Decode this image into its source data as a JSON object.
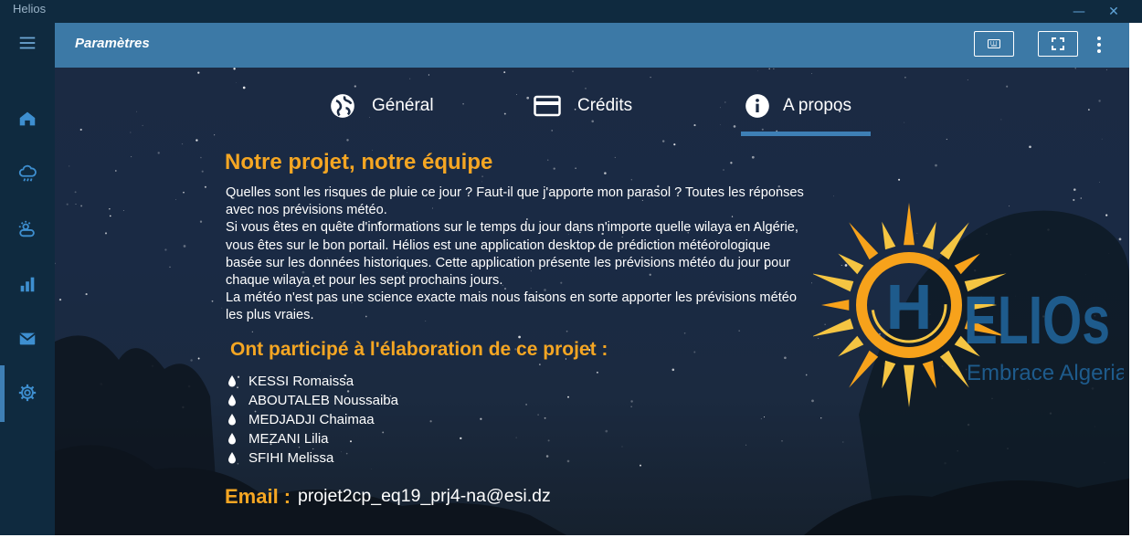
{
  "app": {
    "title": "Helios"
  },
  "window_controls": {
    "minimize": "—",
    "close": "✕"
  },
  "sidebar": {
    "items": [
      {
        "name": "menu",
        "icon": "hamburger-icon"
      },
      {
        "name": "home",
        "icon": "home-icon"
      },
      {
        "name": "cloud-rain",
        "icon": "cloud-rain-icon"
      },
      {
        "name": "weather",
        "icon": "sun-cloud-icon"
      },
      {
        "name": "stats",
        "icon": "bar-chart-icon"
      },
      {
        "name": "mail",
        "icon": "mail-icon"
      },
      {
        "name": "settings",
        "icon": "gear-icon",
        "active": true
      }
    ]
  },
  "header": {
    "title": "Paramètres",
    "buttons": [
      {
        "icon": "keyboard-icon"
      },
      {
        "icon": "fullscreen-icon"
      },
      {
        "icon": "more-vertical-icon"
      }
    ]
  },
  "tabs": [
    {
      "label": "Général",
      "icon": "globe-icon"
    },
    {
      "label": "Crédits",
      "icon": "credit-card-icon"
    },
    {
      "label": "A propos",
      "icon": "info-icon",
      "active": true
    }
  ],
  "about": {
    "title": "Notre projet, notre équipe",
    "paragraphs": [
      "Quelles sont les risques de pluie ce jour ? Faut-il que j'apporte mon parasol ? Toutes les réponses avec nos prévisions météo.",
      "Si vous êtes en quête d'informations sur le temps du jour dans n'importe quelle wilaya en Algérie, vous êtes sur le bon portail. Hélios est une application desktop de prédiction météorologique basée sur les données historiques. Cette application présente les prévisions météo du jour pour chaque wilaya et pour les sept prochains jours.",
      "La météo n'est pas une science exacte mais nous faisons en sorte apporter les prévisions météo les plus vraies."
    ],
    "team_title": "Ont participé à l'élaboration de ce projet :",
    "team": [
      "KESSI Romaissa",
      "ABOUTALEB Noussaiba",
      "MEDJADJI Chaimaa",
      "MEZANI Lilia",
      "SFIHI Melissa"
    ],
    "email_label": "Email :",
    "email": "projet2cp_eq19_prj4-na@esi.dz"
  },
  "logo": {
    "text_h": "H",
    "text_rest": "ELIOs",
    "tagline": "Embrace Algeria"
  },
  "colors": {
    "accent": "#f5a623",
    "brand_blue": "#3c79a6",
    "sidebar": "#0f2a3f",
    "logo_blue": "#1e5b8c"
  }
}
